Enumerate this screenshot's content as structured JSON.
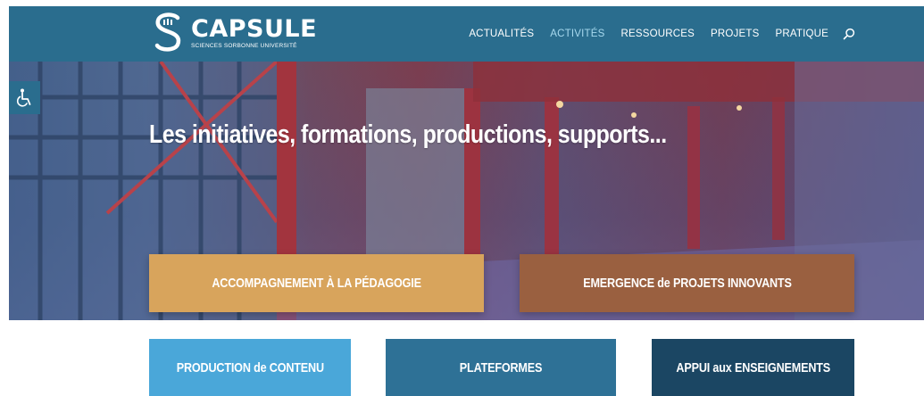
{
  "header": {
    "logo_name": "CAPSULE",
    "logo_subtitle": "SCIENCES SORBONNE UNIVERSITÉ",
    "nav": [
      {
        "label": "ACTUALITÉS",
        "active": false
      },
      {
        "label": "ACTIVITÉS",
        "active": true
      },
      {
        "label": "RESSOURCES",
        "active": false
      },
      {
        "label": "PROJETS",
        "active": false
      },
      {
        "label": "PRATIQUE",
        "active": false
      }
    ],
    "search_icon": "search-icon"
  },
  "accessibility": {
    "icon": "wheelchair-icon"
  },
  "hero": {
    "headline": "Les initiatives, formations, productions, supports..."
  },
  "buttons": {
    "pedagogie": "ACCOMPAGNEMENT À LA PÉDAGOGIE",
    "innovants": "EMERGENCE de PROJETS INNOVANTS",
    "contenu": "PRODUCTION de CONTENU",
    "plateformes": "PLATEFORMES",
    "enseignements": "APPUI aux ENSEIGNEMENTS"
  },
  "colors": {
    "header_bg": "#2a6d8e",
    "nav_active": "#a7d9ee",
    "pedagogie": "#d8a45c",
    "innovants": "#9a6040",
    "contenu": "#4aa7d9",
    "plateformes": "#2e7196",
    "enseignements": "#1b4663"
  }
}
